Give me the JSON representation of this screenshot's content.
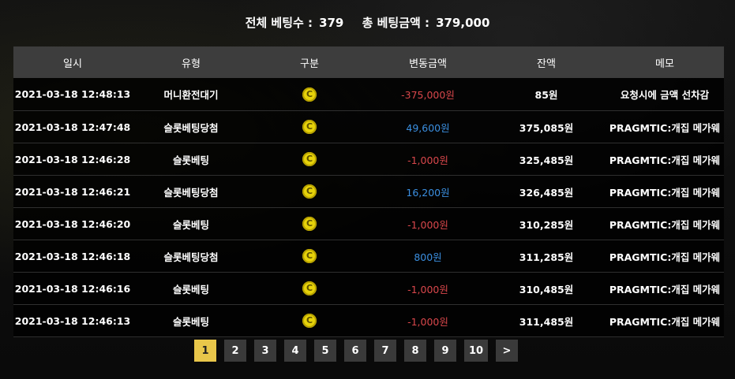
{
  "summary": {
    "total_bets_label": "전체 베팅수 :",
    "total_bets_value": "379",
    "total_amount_label": "총 베팅금액 :",
    "total_amount_value": "379,000"
  },
  "table": {
    "headers": [
      "일시",
      "유형",
      "구분",
      "변동금액",
      "잔액",
      "메모"
    ],
    "rows": [
      {
        "datetime": "2021-03-18 12:48:13",
        "type": "머니환전대기",
        "category_icon": "coin-icon",
        "change": "-375,000원",
        "change_sign": "neg",
        "balance": "85원",
        "memo": "요청시에 금액 선차감"
      },
      {
        "datetime": "2021-03-18 12:47:48",
        "type": "슬롯베팅당첨",
        "category_icon": "coin-icon",
        "change": "49,600원",
        "change_sign": "pos",
        "balance": "375,085원",
        "memo": "PRAGMTIC:개집 메가웨"
      },
      {
        "datetime": "2021-03-18 12:46:28",
        "type": "슬롯베팅",
        "category_icon": "coin-icon",
        "change": "-1,000원",
        "change_sign": "neg",
        "balance": "325,485원",
        "memo": "PRAGMTIC:개집 메가웨"
      },
      {
        "datetime": "2021-03-18 12:46:21",
        "type": "슬롯베팅당첨",
        "category_icon": "coin-icon",
        "change": "16,200원",
        "change_sign": "pos",
        "balance": "326,485원",
        "memo": "PRAGMTIC:개집 메가웨"
      },
      {
        "datetime": "2021-03-18 12:46:20",
        "type": "슬롯베팅",
        "category_icon": "coin-icon",
        "change": "-1,000원",
        "change_sign": "neg",
        "balance": "310,285원",
        "memo": "PRAGMTIC:개집 메가웨"
      },
      {
        "datetime": "2021-03-18 12:46:18",
        "type": "슬롯베팅당첨",
        "category_icon": "coin-icon",
        "change": "800원",
        "change_sign": "pos",
        "balance": "311,285원",
        "memo": "PRAGMTIC:개집 메가웨"
      },
      {
        "datetime": "2021-03-18 12:46:16",
        "type": "슬롯베팅",
        "category_icon": "coin-icon",
        "change": "-1,000원",
        "change_sign": "neg",
        "balance": "310,485원",
        "memo": "PRAGMTIC:개집 메가웨"
      },
      {
        "datetime": "2021-03-18 12:46:13",
        "type": "슬롯베팅",
        "category_icon": "coin-icon",
        "change": "-1,000원",
        "change_sign": "neg",
        "balance": "311,485원",
        "memo": "PRAGMTIC:개집 메가웨"
      }
    ]
  },
  "pagination": {
    "pages": [
      "1",
      "2",
      "3",
      "4",
      "5",
      "6",
      "7",
      "8",
      "9",
      "10"
    ],
    "current": "1",
    "next_label": ">"
  },
  "colors": {
    "negative": "#d9474b",
    "positive": "#3b8fe0",
    "active_page": "#e8c64a",
    "coin": "#e6d20a"
  }
}
